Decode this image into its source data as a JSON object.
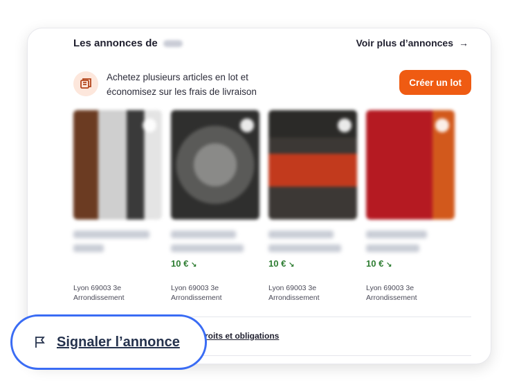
{
  "header": {
    "title": "Les annonces de",
    "see_more": "Voir plus d’annonces",
    "see_more_arrow": "→"
  },
  "bundle": {
    "text": "Achetez plusieurs articles en lot et économisez sur les frais de livraison",
    "button": "Créer un lot"
  },
  "products": [
    {
      "price": "",
      "location": "Lyon 69003 3e Arrondissement"
    },
    {
      "price": "10 €",
      "location": "Lyon 69003 3e Arrondissement"
    },
    {
      "price": "10 €",
      "location": "Lyon 69003 3e Arrondissement"
    },
    {
      "price": "10 €",
      "location": "Lyon 69003 3e Arrondissement"
    }
  ],
  "footer": {
    "rights_link": "roits et obligations"
  },
  "report": {
    "label": "Signaler l’annonce"
  },
  "colors": {
    "accent": "#ef5b12",
    "price": "#2e7d32",
    "callout_border": "#3a6cf4"
  }
}
